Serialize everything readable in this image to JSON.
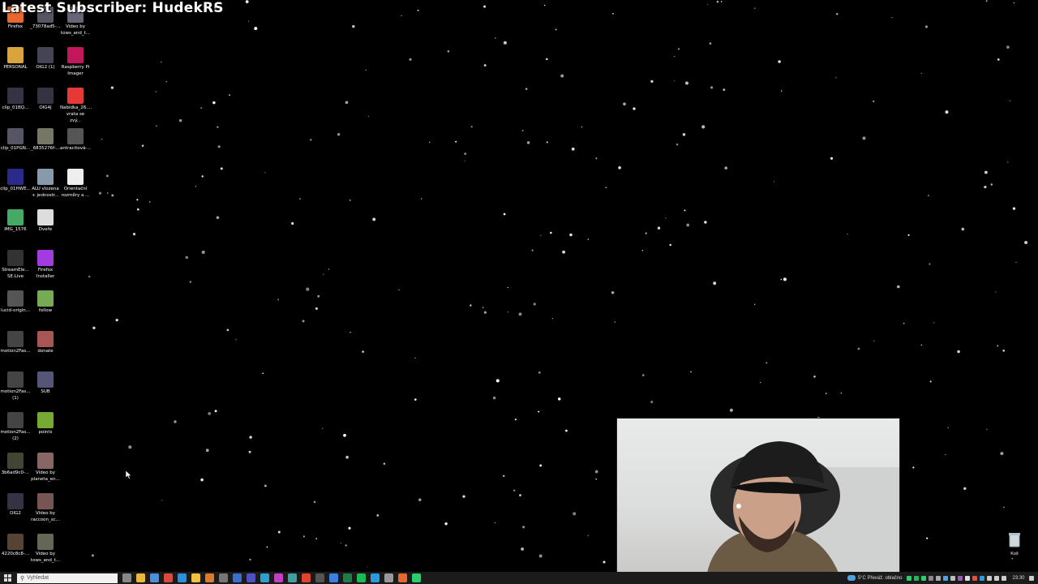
{
  "overlay": {
    "subscriber_text": "Latest Subscriber: HudekRS"
  },
  "desktop_icons": [
    {
      "label": "Firefox",
      "icon": "firefox-icon",
      "color": "#e8672e"
    },
    {
      "label": "_73078ad5-...",
      "icon": "image-icon",
      "color": "#556"
    },
    {
      "label": "Video by\ntows_and_t...",
      "icon": "video-icon",
      "color": "#667"
    },
    {
      "label": "PERSONAL",
      "icon": "folder-icon",
      "color": "#d9a43c"
    },
    {
      "label": "OIG2 (1)",
      "icon": "image-icon",
      "color": "#445"
    },
    {
      "label": "Raspberry Pi\nImager",
      "icon": "raspberry-pi-icon",
      "color": "#c2185b"
    },
    {
      "label": "clip_01BQ...",
      "icon": "image-icon",
      "color": "#334"
    },
    {
      "label": "OIG4J",
      "icon": "image-icon",
      "color": "#334"
    },
    {
      "label": "Nabídka_26....\nvrata se zvý...",
      "icon": "pdf-icon",
      "color": "#e53935"
    },
    {
      "label": "clip_01PGN...",
      "icon": "image-icon",
      "color": "#556"
    },
    {
      "label": "_6835276f-...",
      "icon": "image-icon",
      "color": "#776"
    },
    {
      "label": "antracitová-...",
      "icon": "image-icon",
      "color": "#555"
    },
    {
      "label": "clip_01HWE...",
      "icon": "image-icon",
      "color": "#2a2a8a"
    },
    {
      "label": "ALU vlozena\n+ jednostr...",
      "icon": "image-icon",
      "color": "#8899aa"
    },
    {
      "label": "Orientační\nrozměry a ...",
      "icon": "document-icon",
      "color": "#eeeeee"
    },
    {
      "label": "IMG_1576",
      "icon": "image-icon",
      "color": "#4a6"
    },
    {
      "label": "Dveře",
      "icon": "image-icon",
      "color": "#ddd"
    },
    {
      "label": "StreamEle...\nSE.Live",
      "icon": "streamelements-icon",
      "color": "#333"
    },
    {
      "label": "Firefox\nInstaller",
      "icon": "firefox-installer-icon",
      "color": "#a33ce0"
    },
    {
      "label": "lucid-origin...",
      "icon": "image-icon",
      "color": "#555"
    },
    {
      "label": "follow",
      "icon": "image-icon",
      "color": "#7a5"
    },
    {
      "label": "motion2Fas...",
      "icon": "image-icon",
      "color": "#444"
    },
    {
      "label": "donate",
      "icon": "image-icon",
      "color": "#a55"
    },
    {
      "label": "motion2Fas...\n(1)",
      "icon": "image-icon",
      "color": "#444"
    },
    {
      "label": "SUB",
      "icon": "image-icon",
      "color": "#557"
    },
    {
      "label": "motion2Fas...\n(2)",
      "icon": "image-icon",
      "color": "#444"
    },
    {
      "label": "points",
      "icon": "image-icon",
      "color": "#7a3"
    },
    {
      "label": "3b6ad9c0-...",
      "icon": "image-icon",
      "color": "#443"
    },
    {
      "label": "Video by\nplaneta_en...",
      "icon": "video-icon",
      "color": "#866"
    },
    {
      "label": "OIG2",
      "icon": "image-icon",
      "color": "#334"
    },
    {
      "label": "Video by\nraccoon_sc...",
      "icon": "video-icon",
      "color": "#755"
    },
    {
      "label": "4220c8c8-...",
      "icon": "image-icon",
      "color": "#543"
    },
    {
      "label": "Video by\ntows_and_t...",
      "icon": "video-icon",
      "color": "#665"
    }
  ],
  "recycle_bin": {
    "label": "Koš",
    "icon": "recycle-bin-icon"
  },
  "taskbar": {
    "search_placeholder": "Vyhledat",
    "weather": "5°C  Převáž. oblačno",
    "clock": "23:30",
    "pinned": [
      {
        "icon": "task-view-icon",
        "color": "#888"
      },
      {
        "icon": "file-explorer-icon",
        "color": "#e8b93a"
      },
      {
        "icon": "store-icon",
        "color": "#4a8fe0"
      },
      {
        "icon": "chrome-icon",
        "color": "#d94b3b"
      },
      {
        "icon": "vscode-icon",
        "color": "#2b8fe0"
      },
      {
        "icon": "folder-icon",
        "color": "#f0c040"
      },
      {
        "icon": "app-icon",
        "color": "#e07a2b"
      },
      {
        "icon": "app-icon",
        "color": "#777"
      },
      {
        "icon": "app-icon",
        "color": "#3a6fd0"
      },
      {
        "icon": "app-icon",
        "color": "#5050c0"
      },
      {
        "icon": "app-icon",
        "color": "#2ba0d0"
      },
      {
        "icon": "app-icon",
        "color": "#c040c0"
      },
      {
        "icon": "app-icon",
        "color": "#40a0a0"
      },
      {
        "icon": "brave-icon",
        "color": "#e0452b"
      },
      {
        "icon": "app-icon",
        "color": "#555"
      },
      {
        "icon": "app-icon",
        "color": "#3a80e0"
      },
      {
        "icon": "excel-icon",
        "color": "#1e7e45"
      },
      {
        "icon": "spotify-icon",
        "color": "#1db954"
      },
      {
        "icon": "app-icon",
        "color": "#2a9ae0"
      },
      {
        "icon": "app-icon",
        "color": "#999"
      },
      {
        "icon": "firefox-icon",
        "color": "#e8672e"
      },
      {
        "icon": "app-icon",
        "color": "#2ecc71"
      }
    ]
  }
}
